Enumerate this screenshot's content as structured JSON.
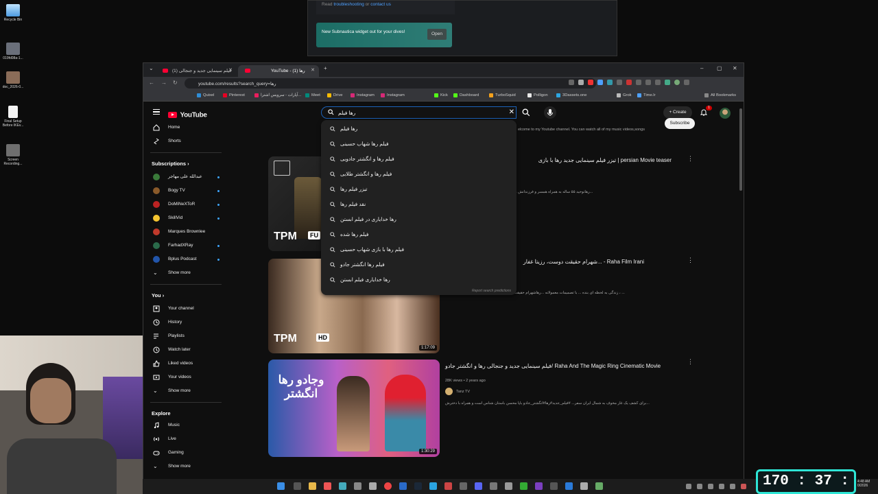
{
  "desktop": {
    "icons": [
      {
        "label": "Recycle Bin"
      },
      {
        "label": "019fd08a-1..."
      },
      {
        "label": "doc_2026-0..."
      },
      {
        "label": "Final Setup Before IKEv..."
      },
      {
        "label": "Screen Recording..."
      }
    ]
  },
  "bg_window": {
    "note_prefix": "Read ",
    "note_link1": "troubleshooting",
    "note_mid": " or ",
    "note_link2": "contact us",
    "toast_text": "New Subnautica widget out for your dives!",
    "toast_button": "Open"
  },
  "browser": {
    "tabs": [
      {
        "label": "فیلم سینمایی جدید و جنجالی (1)"
      },
      {
        "label": "YouTube - رها (1)"
      }
    ],
    "url": "youtube.com/results?search_query=رها",
    "bookmarks": [
      {
        "label": "Quixel",
        "color": "#2f8dd6"
      },
      {
        "label": "Pinterest",
        "color": "#e60023"
      },
      {
        "label": "آپارات - سرویس اشترا...",
        "color": "#ea1d5d"
      },
      {
        "label": "Meet",
        "color": "#00897b"
      },
      {
        "label": "Drive",
        "color": "#fbbc04"
      },
      {
        "label": "Instagram",
        "color": "#d62976"
      },
      {
        "label": "Instagram",
        "color": "#d62976"
      },
      {
        "label": "Kick",
        "color": "#53fc18"
      },
      {
        "label": "Dashboard",
        "color": "#53fc18"
      },
      {
        "label": "TurboSquid",
        "color": "#f3a11c"
      },
      {
        "label": "Polligon",
        "color": "#e8e8e8"
      },
      {
        "label": "3Dassets.one",
        "color": "#2da6e2"
      },
      {
        "label": "Grok",
        "color": "#bbbbbb"
      },
      {
        "label": "Time.lr",
        "color": "#4ea1ff"
      }
    ],
    "all_bookmarks": "All Bookmarks"
  },
  "youtube": {
    "logo": "YouTube",
    "search": {
      "value": "رها فیلم",
      "placeholder": "Search"
    },
    "create_label": "Create",
    "notif_count": "1",
    "subscribe_label": "Subscribe",
    "channel_blurb": "elcome to my Youtube channel. You can watch all of my music videos,songs",
    "suggestions": [
      "رها فیلم",
      "فیلم رها شهاب حسینی",
      "فیلم رها و انگشتر جادویی",
      "فیلم رها و انگشتر طلایی",
      "تیزر فیلم رها",
      "نقد فیلم رها",
      "رها خدایاری در فیلم ابستن",
      "فیلم رها شده",
      "فیلم رها با بازی شهاب حسینی",
      "فیلم رها انگشتر جادو",
      "رها خدایاری فیلم ابستن"
    ],
    "report_label": "Report search predictions",
    "sidebar": {
      "home": "Home",
      "shorts": "Shorts",
      "subscriptions": "Subscriptions",
      "channels": [
        {
          "name": "عبدالله علی مهاجر",
          "color": "#3a7a3a"
        },
        {
          "name": "Bogy TV",
          "color": "#8a5a2a"
        },
        {
          "name": "DoMiNeXToR",
          "color": "#b22"
        },
        {
          "name": "SkillVid",
          "color": "#f4c430"
        },
        {
          "name": "Marques Brownlee",
          "color": "#c0392b"
        },
        {
          "name": "FarhadXRay",
          "color": "#2a6a4a"
        },
        {
          "name": "Bplus Podcast",
          "color": "#2255aa"
        }
      ],
      "show_more": "Show more",
      "you": "You",
      "you_items": [
        "Your channel",
        "History",
        "Playlists",
        "Watch later",
        "Liked videos",
        "Your videos"
      ],
      "show_more_2": "Show more",
      "explore": "Explore",
      "explore_items": [
        "Music",
        "Live",
        "Gaming"
      ],
      "show_more_3": "Show more"
    },
    "videos": [
      {
        "title": "تیزر فیلم سینمایی جدید رها با بازی | persian Movie teaser",
        "desc": "رهانوحید ۵۵ ساله به همراه همسر و فرزندانش زندگی متوسطی دارند. تا اینکه یک اتفاق، داستا...",
        "thumb_text": "TPM",
        "badge": "FU"
      },
      {
        "title": "شهرام حقیقت دوست، رزیتا غفار... - Raha Film Irani",
        "desc": "زندگی به لحظه ای بنده ... با تصمیمات معمولانه ...رهاشهرام حقیقت دوست ، کیومرث ملک مطیعی ، رزیتا غفاری ، ...",
        "thumb_text": "TPM",
        "badge": "HD",
        "duration": "1:17:09"
      },
      {
        "title": "فیلم سینمایی جدید و جنجالی رها و انگشتر جادو/ Raha And The Magic Ring Cinematic Movie",
        "views": "28K views",
        "age": "2 years ago",
        "channel": "Tanz TV",
        "desc": "برای کشف یک غار مخوف به شمال ایران سفر... #فیلم_جدید#رها#انگشتر_جادو باپا محسن باستان شناس است و همراه با دخترش...",
        "thumb_text": "وجادو رها انگشتر",
        "duration": "1:30:29"
      }
    ]
  },
  "taskbar": {
    "timer": "170 : 37 : 10",
    "clock_time": "4:48 AM",
    "clock_date": "0/2026"
  }
}
